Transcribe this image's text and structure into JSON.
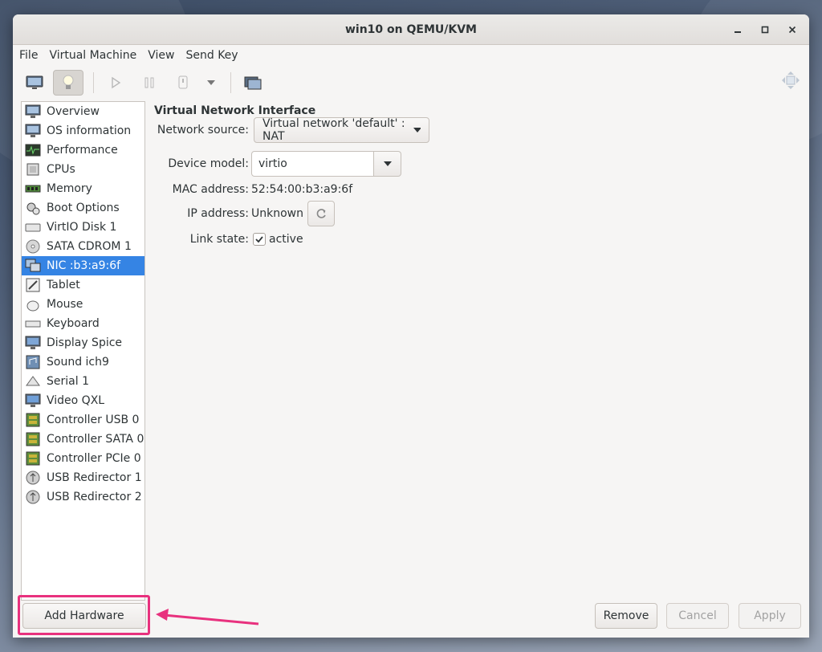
{
  "window": {
    "title": "win10 on QEMU/KVM"
  },
  "menu": [
    "File",
    "Virtual Machine",
    "View",
    "Send Key"
  ],
  "toolbar": {
    "icons": [
      "monitor-icon",
      "lightbulb-icon",
      "play-icon",
      "pause-icon",
      "power-icon",
      "dropdown-icon",
      "screenshot-icon",
      "fullscreen-icon"
    ]
  },
  "sidebar": {
    "items": [
      {
        "label": "Overview",
        "icon": "monitor-icon"
      },
      {
        "label": "OS information",
        "icon": "monitor-icon"
      },
      {
        "label": "Performance",
        "icon": "performance-icon"
      },
      {
        "label": "CPUs",
        "icon": "cpu-icon"
      },
      {
        "label": "Memory",
        "icon": "memory-icon"
      },
      {
        "label": "Boot Options",
        "icon": "gears-icon"
      },
      {
        "label": "VirtIO Disk 1",
        "icon": "disk-icon"
      },
      {
        "label": "SATA CDROM 1",
        "icon": "cdrom-icon"
      },
      {
        "label": "NIC :b3:a9:6f",
        "icon": "nic-icon"
      },
      {
        "label": "Tablet",
        "icon": "tablet-icon"
      },
      {
        "label": "Mouse",
        "icon": "mouse-icon"
      },
      {
        "label": "Keyboard",
        "icon": "keyboard-icon"
      },
      {
        "label": "Display Spice",
        "icon": "display-icon"
      },
      {
        "label": "Sound ich9",
        "icon": "sound-icon"
      },
      {
        "label": "Serial 1",
        "icon": "serial-icon"
      },
      {
        "label": "Video QXL",
        "icon": "video-icon"
      },
      {
        "label": "Controller USB 0",
        "icon": "controller-icon"
      },
      {
        "label": "Controller SATA 0",
        "icon": "controller-icon"
      },
      {
        "label": "Controller PCIe 0",
        "icon": "controller-icon"
      },
      {
        "label": "USB Redirector 1",
        "icon": "usb-icon"
      },
      {
        "label": "USB Redirector 2",
        "icon": "usb-icon"
      }
    ],
    "selected_index": 8
  },
  "nic": {
    "section_title": "Virtual Network Interface",
    "network_source_label": "Network source:",
    "network_source_value": "Virtual network 'default' : NAT",
    "device_model_label": "Device model:",
    "device_model_value": "virtio",
    "mac_label": "MAC address:",
    "mac_value": "52:54:00:b3:a9:6f",
    "ip_label": "IP address:",
    "ip_value": "Unknown",
    "link_state_label": "Link state:",
    "link_state_value": "active",
    "link_state_checked": true
  },
  "buttons": {
    "add_hardware": "Add Hardware",
    "remove": "Remove",
    "cancel": "Cancel",
    "apply": "Apply"
  },
  "colors": {
    "selection": "#3584e4",
    "annotation": "#e8317e"
  }
}
